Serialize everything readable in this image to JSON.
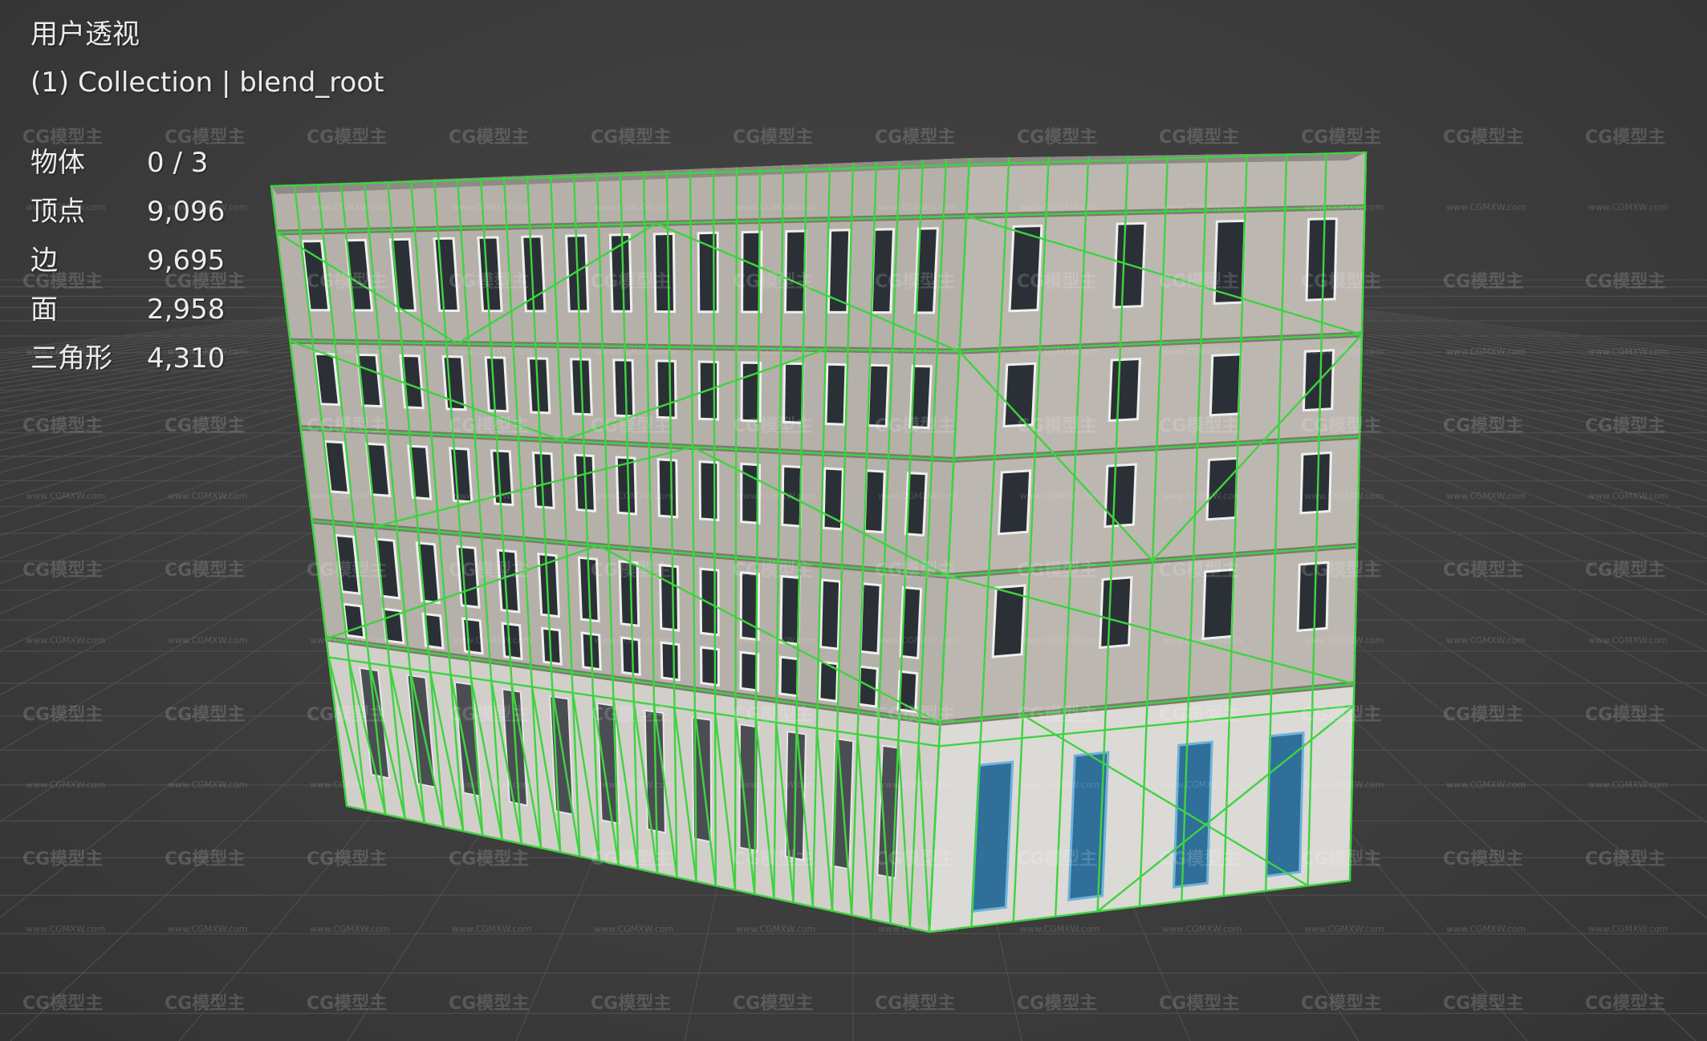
{
  "viewport": {
    "view_name": "用户透视",
    "collection_label": "(1) Collection | blend_root"
  },
  "stats": [
    {
      "label": "物体",
      "value": "0 / 3"
    },
    {
      "label": "顶点",
      "value": "9,096"
    },
    {
      "label": "边",
      "value": "9,695"
    },
    {
      "label": "面",
      "value": "2,958"
    },
    {
      "label": "三角形",
      "value": "4,310"
    }
  ],
  "watermark": {
    "logo": "CG模型主",
    "url": "www.CGMXW.com"
  },
  "colors": {
    "background": "#3a3a3a",
    "grid": "#4e4e4e",
    "wireframe": "#3fd33f",
    "facade": "#b9b3ad",
    "window_frame": "#eef0ee"
  }
}
